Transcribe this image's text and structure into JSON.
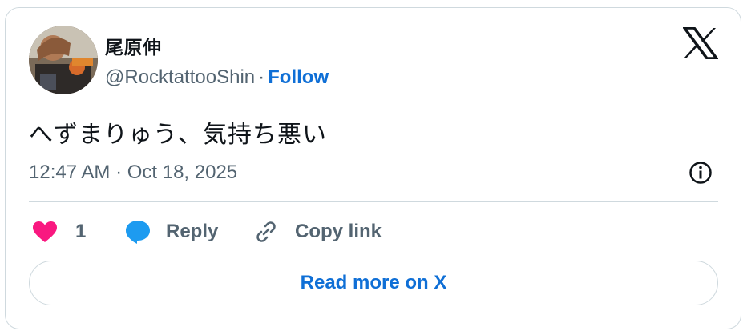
{
  "author": {
    "display_name": "尾原伸",
    "handle": "@RocktattooShin",
    "separator": "·",
    "follow_label": "Follow"
  },
  "tweet": {
    "text": "へずまりゅう、気持ち悪い",
    "timestamp": "12:47 AM · Oct 18, 2025"
  },
  "actions": {
    "like_count": "1",
    "reply_label": "Reply",
    "copy_link_label": "Copy link"
  },
  "read_more_label": "Read more on X",
  "colors": {
    "like": "#f91880",
    "reply": "#1d9bf0",
    "link_blue": "#0f6fd6",
    "muted_text": "#536471",
    "border": "#cfd9de"
  },
  "icons": [
    "x-logo-icon",
    "info-icon",
    "heart-icon",
    "reply-bubble-icon",
    "link-icon"
  ]
}
